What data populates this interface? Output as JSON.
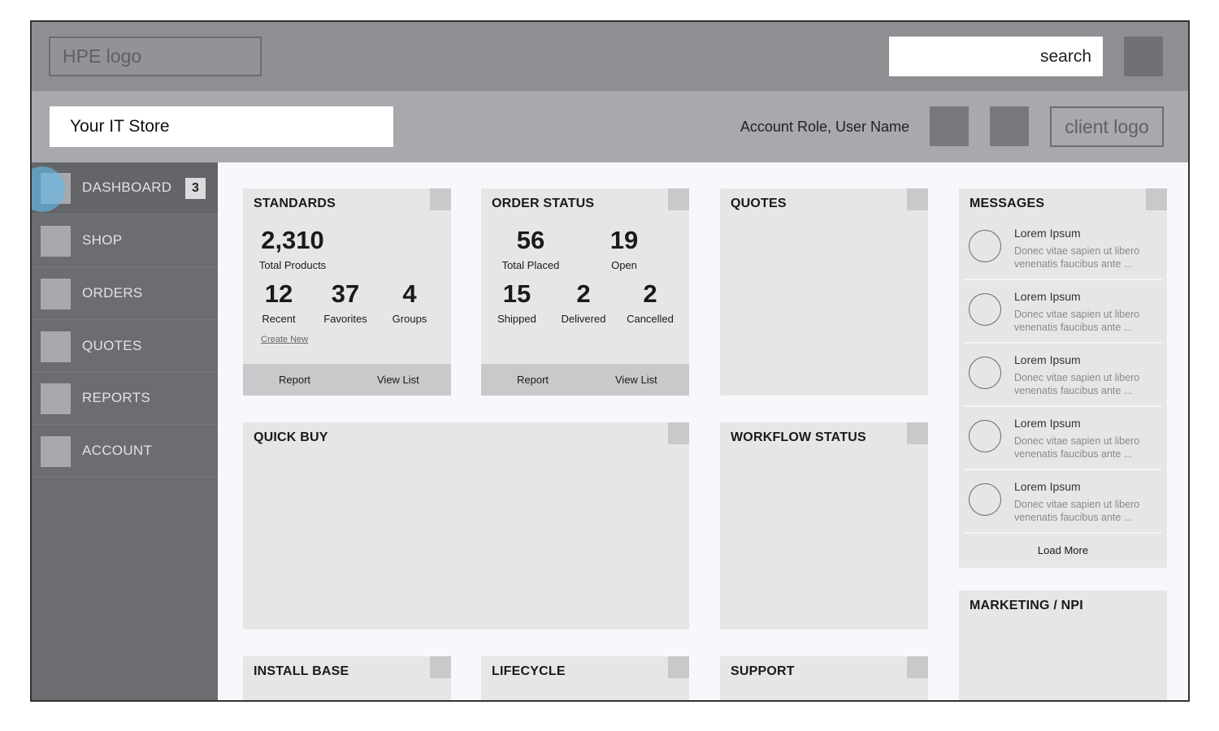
{
  "header": {
    "logo_text": "HPE logo",
    "search_placeholder": "search",
    "store_title": "Your IT Store",
    "account_text": "Account Role, User Name",
    "client_logo_text": "client logo"
  },
  "sidebar": {
    "items": [
      {
        "label": "DASHBOARD",
        "badge": "3",
        "active": true
      },
      {
        "label": "SHOP"
      },
      {
        "label": "ORDERS"
      },
      {
        "label": "QUOTES"
      },
      {
        "label": "REPORTS"
      },
      {
        "label": "ACCOUNT"
      }
    ]
  },
  "cards": {
    "standards": {
      "title": "STANDARDS",
      "total_value": "2,310",
      "total_label": "Total Products",
      "recent_value": "12",
      "recent_label": "Recent",
      "favorites_value": "37",
      "favorites_label": "Favorites",
      "groups_value": "4",
      "groups_label": "Groups",
      "create_new": "Create New",
      "report_label": "Report",
      "view_list_label": "View List"
    },
    "order_status": {
      "title": "ORDER STATUS",
      "placed_value": "56",
      "placed_label": "Total Placed",
      "open_value": "19",
      "open_label": "Open",
      "shipped_value": "15",
      "shipped_label": "Shipped",
      "delivered_value": "2",
      "delivered_label": "Delivered",
      "cancelled_value": "2",
      "cancelled_label": "Cancelled",
      "report_label": "Report",
      "view_list_label": "View List"
    },
    "quotes": {
      "title": "QUOTES"
    },
    "quick_buy": {
      "title": "QUICK BUY"
    },
    "workflow_status": {
      "title": "WORKFLOW STATUS"
    },
    "install_base": {
      "title": "INSTALL BASE"
    },
    "lifecycle": {
      "title": "LIFECYCLE"
    },
    "support": {
      "title": "SUPPORT"
    },
    "marketing": {
      "title": "MARKETING / NPI"
    },
    "messages": {
      "title": "MESSAGES",
      "items": [
        {
          "title": "Lorem Ipsum",
          "body": "Donec vitae sapien ut libero venenatis faucibus ante ..."
        },
        {
          "title": "Lorem Ipsum",
          "body": "Donec vitae sapien ut libero venenatis faucibus ante ..."
        },
        {
          "title": "Lorem Ipsum",
          "body": "Donec vitae sapien ut libero venenatis faucibus ante ..."
        },
        {
          "title": "Lorem Ipsum",
          "body": "Donec vitae sapien ut libero venenatis faucibus ante ..."
        },
        {
          "title": "Lorem Ipsum",
          "body": "Donec vitae sapien ut libero venenatis faucibus ante ..."
        }
      ],
      "load_more": "Load More"
    }
  }
}
